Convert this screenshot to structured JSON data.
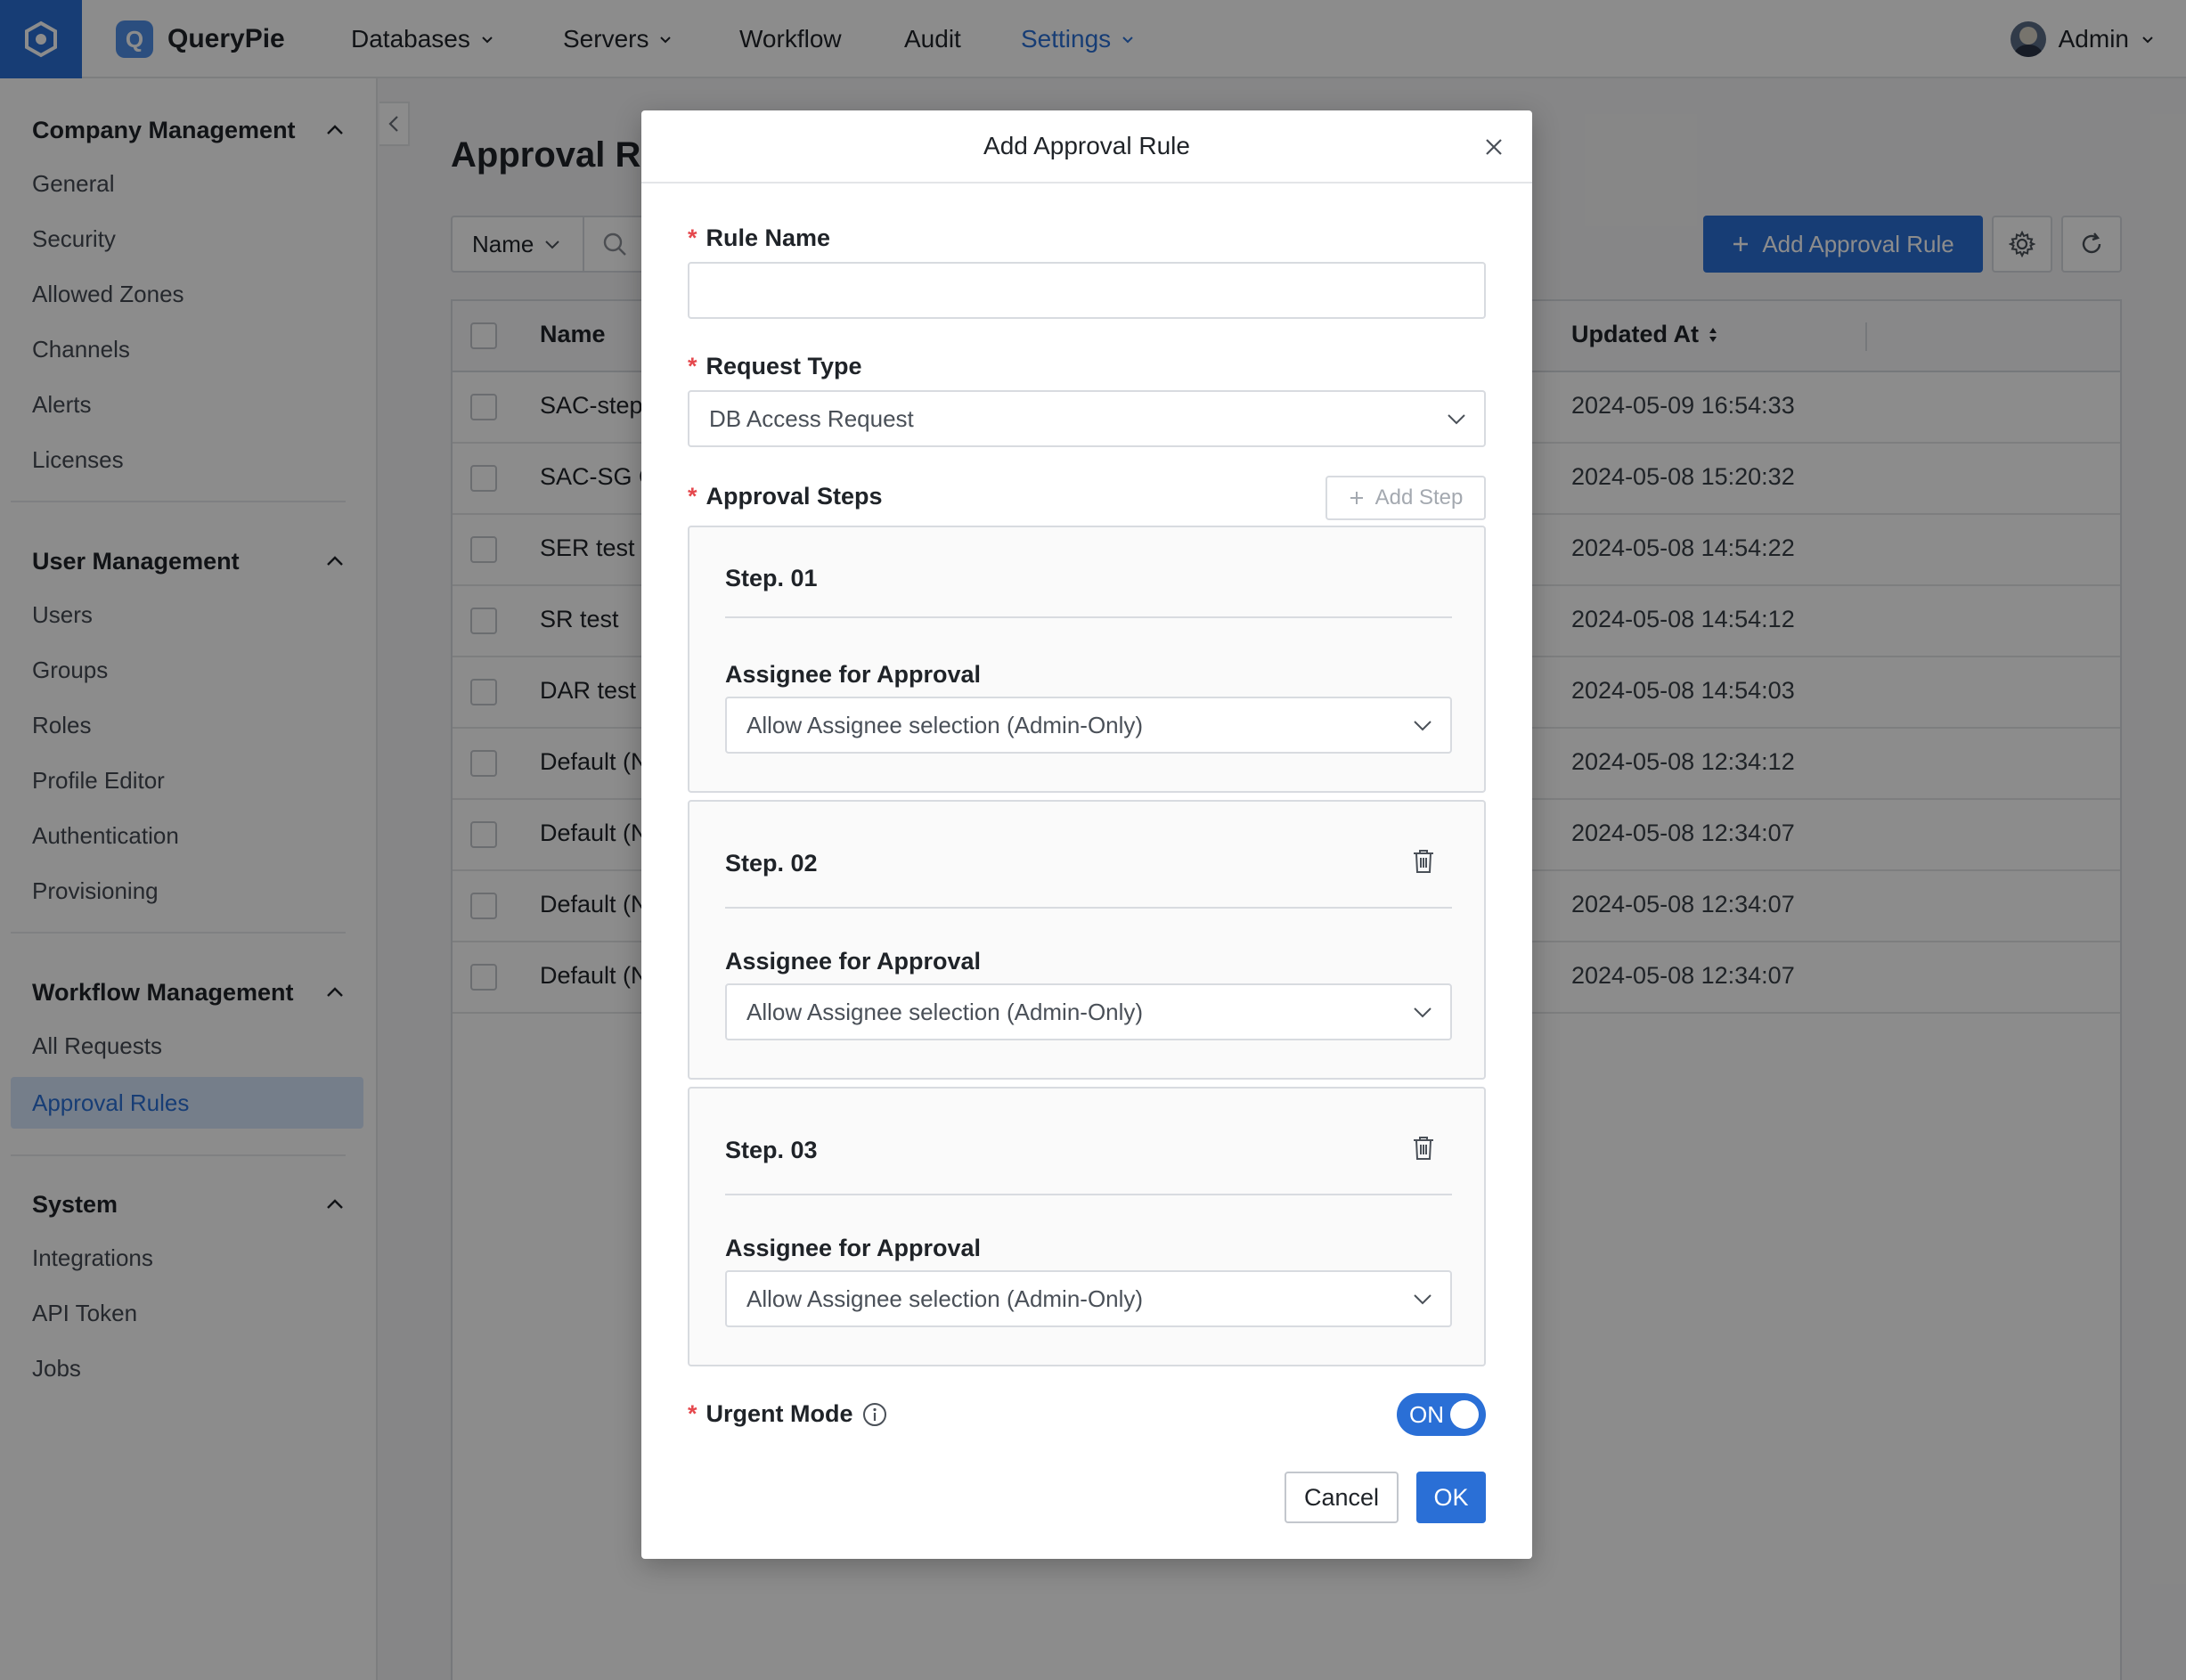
{
  "nav": {
    "brand": "QueryPie",
    "brand_letter": "Q",
    "items": [
      {
        "label": "Databases",
        "has_menu": true
      },
      {
        "label": "Servers",
        "has_menu": true
      },
      {
        "label": "Workflow",
        "has_menu": false
      },
      {
        "label": "Audit",
        "has_menu": false
      },
      {
        "label": "Settings",
        "has_menu": true,
        "active": true
      }
    ],
    "user": "Admin"
  },
  "sidebar": {
    "groups": [
      {
        "title": "Company Management",
        "items": [
          "General",
          "Security",
          "Allowed Zones",
          "Channels",
          "Alerts",
          "Licenses"
        ]
      },
      {
        "title": "User Management",
        "items": [
          "Users",
          "Groups",
          "Roles",
          "Profile Editor",
          "Authentication",
          "Provisioning"
        ]
      },
      {
        "title": "Workflow Management",
        "items": [
          "All Requests",
          "Approval Rules"
        ],
        "active_item": "Approval Rules"
      },
      {
        "title": "System",
        "items": [
          "Integrations",
          "API Token",
          "Jobs"
        ]
      }
    ]
  },
  "main": {
    "title": "Approval Rules",
    "filter_select": "Name",
    "add_button": "Add Approval Rule",
    "table": {
      "columns": [
        "Name",
        "Updated At"
      ],
      "rows": [
        {
          "name": "SAC-step",
          "updated": "2024-05-09 16:54:33"
        },
        {
          "name": "SAC-SG C",
          "updated": "2024-05-08 15:20:32"
        },
        {
          "name": "SER test",
          "updated": "2024-05-08 14:54:22"
        },
        {
          "name": "SR test",
          "updated": "2024-05-08 14:54:12"
        },
        {
          "name": "DAR test",
          "updated": "2024-05-08 14:54:03"
        },
        {
          "name": "Default (N",
          "updated": "2024-05-08 12:34:12"
        },
        {
          "name": "Default (N",
          "updated": "2024-05-08 12:34:07"
        },
        {
          "name": "Default (N",
          "updated": "2024-05-08 12:34:07"
        },
        {
          "name": "Default (N",
          "updated": "2024-05-08 12:34:07"
        }
      ]
    }
  },
  "modal": {
    "title": "Add Approval Rule",
    "required_mark": "*",
    "rule_name_label": "Rule Name",
    "rule_name_value": "",
    "request_type_label": "Request Type",
    "request_type_value": "DB Access Request",
    "approval_steps_label": "Approval Steps",
    "add_step_label": "Add Step",
    "steps": [
      {
        "title": "Step. 01",
        "assignee_label": "Assignee for Approval",
        "assignee_value": "Allow Assignee selection (Admin-Only)",
        "deletable": false
      },
      {
        "title": "Step. 02",
        "assignee_label": "Assignee for Approval",
        "assignee_value": "Allow Assignee selection (Admin-Only)",
        "deletable": true
      },
      {
        "title": "Step. 03",
        "assignee_label": "Assignee for Approval",
        "assignee_value": "Allow Assignee selection (Admin-Only)",
        "deletable": true
      }
    ],
    "urgent_mode_label": "Urgent Mode",
    "urgent_mode_state": "ON",
    "cancel_label": "Cancel",
    "ok_label": "OK"
  },
  "colors": {
    "accent": "#2a6fd6",
    "required": "#e5484d",
    "active_bg": "#d6e6fb"
  }
}
